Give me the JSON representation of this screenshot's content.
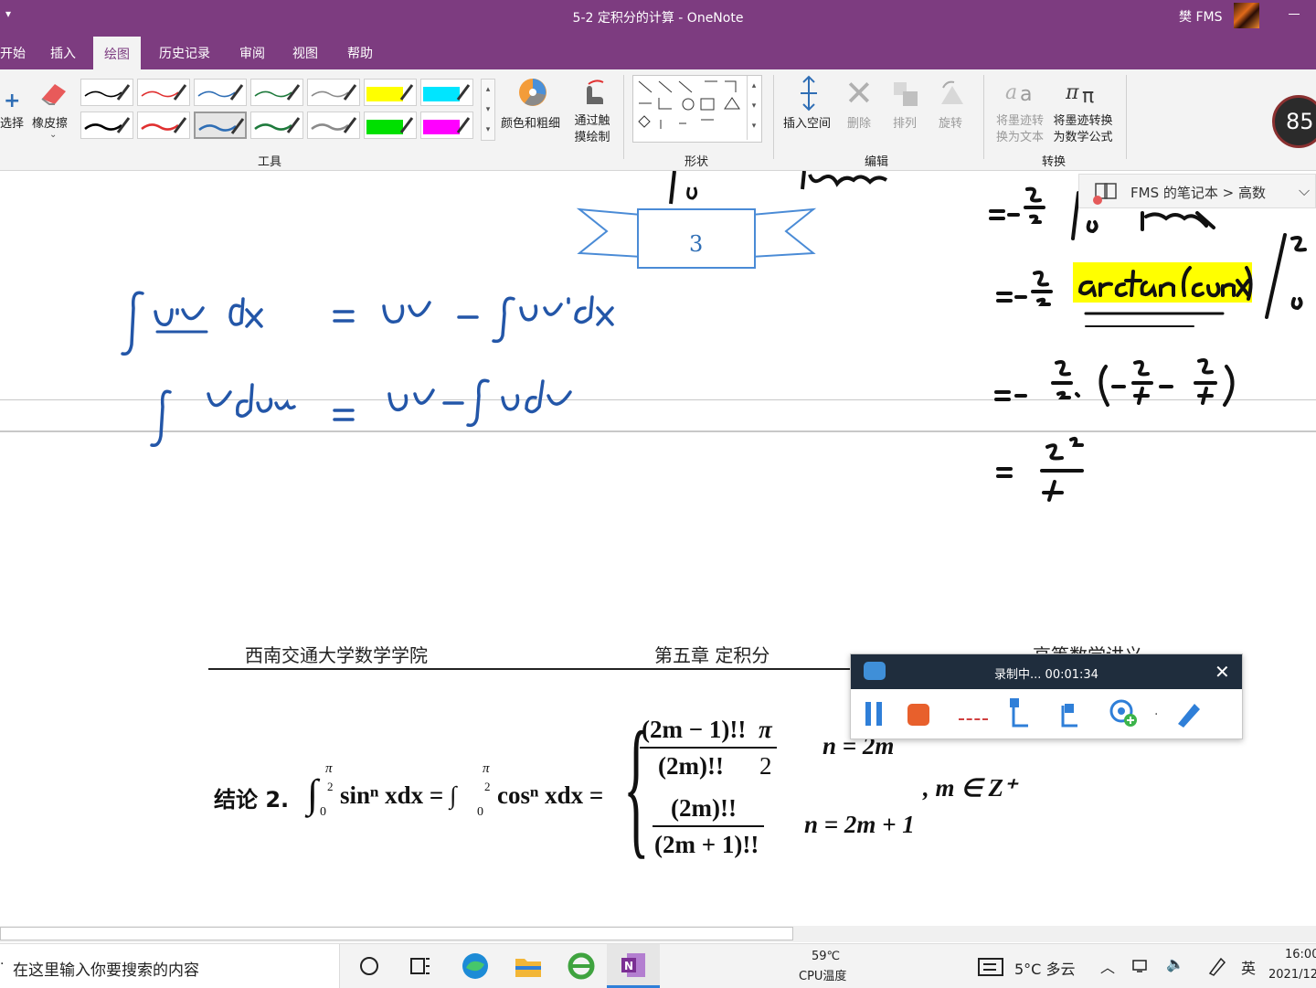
{
  "window": {
    "title": "5-2 定积分的计算 - OneNote",
    "user": "樊 FMS"
  },
  "menu": {
    "tabs": [
      "开始",
      "插入",
      "绘图",
      "历史记录",
      "审阅",
      "视图",
      "帮助"
    ],
    "active_tab": "绘图"
  },
  "ribbon": {
    "select_label": "选择",
    "eraser_label": "橡皮擦",
    "tools_group": "工具",
    "color_thickness": "颜色和粗细",
    "draw_with_touch_1": "通过触",
    "draw_with_touch_2": "摸绘制",
    "shapes_group": "形状",
    "insert_space": "插入空间",
    "delete": "删除",
    "arrange": "排列",
    "rotate": "旋转",
    "edit_group": "编辑",
    "ink_to_text_1": "将墨迹转",
    "ink_to_text_2": "换为文本",
    "ink_to_math_1": "将墨迹转换",
    "ink_to_math_2": "为数学公式",
    "convert_group": "转换",
    "pen_colors": [
      "#000000",
      "#e03030",
      "#2f6eb5",
      "#1e7a3c",
      "#8a8a8a",
      "#ffff00",
      "#00e5ff",
      "#000000",
      "#e03030",
      "#2f6eb5",
      "#1e7a3c",
      "#8a8a8a",
      "#00e000",
      "#ff00ff"
    ]
  },
  "badge": "85",
  "breadcrumb": "FMS 的笔记本 > 高数",
  "note": {
    "banner_number": "3",
    "header_left": "西南交通大学数学学院",
    "header_center": "第五章  定积分",
    "header_right": "高等数学讲义",
    "conclusion_label": "结论 2.",
    "formula_left": "sinⁿ xdx = ∫",
    "formula_mid": "cosⁿ xdx =",
    "case1_num": "(2m − 1)!!",
    "case1_den": "(2m)!!",
    "case1_pi": "π",
    "case1_two": "2",
    "case1_cond": "n = 2m",
    "case2_num": "(2m)!!",
    "case2_den": "(2m + 1)!!",
    "case2_cond": "n = 2m + 1",
    "tail": ", m ∈ Z⁺",
    "int_upper": "π",
    "int_upper_den": "2",
    "int_lower": "0"
  },
  "recorder": {
    "status": "录制中... 00:01:34"
  },
  "taskbar": {
    "search_placeholder": "在这里输入你要搜索的内容",
    "cpu_temp": "59℃",
    "cpu_label": "CPU温度",
    "weather": "5°C  多云",
    "ime": "英",
    "time": "16:00",
    "date": "2021/12"
  }
}
